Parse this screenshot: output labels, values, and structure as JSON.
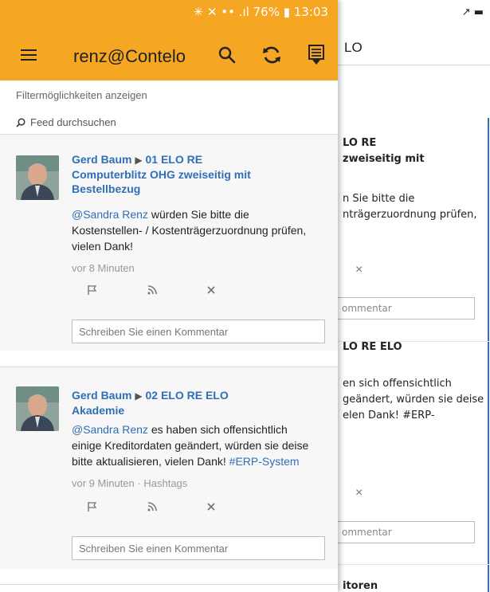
{
  "status": {
    "android_text": "✳ ✕ •• .ıl 76% ▮ 13:03",
    "ios_text": "↗ ▬"
  },
  "background_app": {
    "title": "LO",
    "card1": {
      "line1": "LO RE",
      "line2": "zweiseitig mit",
      "line3": "n Sie bitte die",
      "line4": "nträgerzuordnung prüfen,",
      "x": "×",
      "comment_placeholder": "ommentar"
    },
    "card2": {
      "line1": "LO RE ELO",
      "line2": "en sich offensichtlich",
      "line3": "geändert, würden sie deise",
      "line4": "elen Dank! #ERP-",
      "x": "×",
      "comment_placeholder": "ommentar"
    },
    "card3": {
      "line1": "itoren"
    }
  },
  "drawer": {
    "title": "renz@Contelo",
    "filter_link": "Filtermöglichkeiten anzeigen",
    "search_label": "Feed durchsuchen",
    "header_color": "#f5a623",
    "link_color": "#2f6fb5"
  },
  "posts": [
    {
      "author": "Gerd Baum",
      "arrow": "▶",
      "target_line1": "01 ELO RE",
      "target_line2": "Computerblitz OHG zweiseitig mit",
      "target_line3": "Bestellbezug",
      "mention": "@Sandra Renz",
      "body_rest1": " würden Sie bitte die",
      "body_line2": "Kostenstellen- / Kostenträgerzuordnung prüfen,",
      "body_line3": "vielen Dank!",
      "time": "vor 8 Minuten",
      "extra": "",
      "comment_placeholder": "Schreiben Sie einen Kommentar"
    },
    {
      "author": "Gerd Baum",
      "arrow": "▶",
      "target_line1": "02 ELO RE ELO",
      "target_line2": "Akademie",
      "mention": "@Sandra Renz",
      "body_rest1": " es haben sich offensichtlich",
      "body_line2": "einige Kreditordaten geändert, würden sie deise",
      "body_line3a": "bitte aktualisieren, vielen Dank! ",
      "hashtag": "#ERP-System",
      "time": "vor 9 Minuten",
      "sep": "·",
      "extra": "Hashtags",
      "comment_placeholder": "Schreiben Sie einen Kommentar"
    }
  ]
}
